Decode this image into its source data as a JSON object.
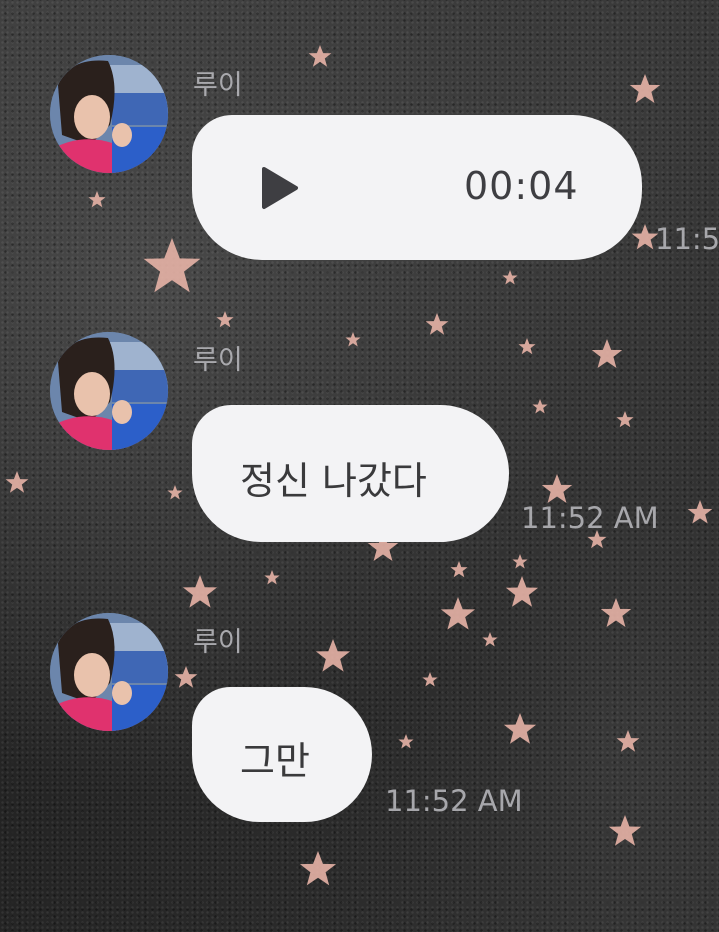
{
  "messages": [
    {
      "sender": "루이",
      "type": "voice",
      "duration": "00:04",
      "time": "11:5"
    },
    {
      "sender": "루이",
      "type": "text",
      "text": "정신 나갔다",
      "time": "11:52 AM"
    },
    {
      "sender": "루이",
      "type": "text",
      "text": "그만",
      "time": "11:52 AM"
    }
  ],
  "icons": {
    "play": "play-icon",
    "avatar": "avatar"
  },
  "colors": {
    "bubble": "#f3f3f5",
    "bubble_text": "#3a3a3c",
    "meta_text": "#a7a7ab",
    "star": "#e8b4a8"
  }
}
